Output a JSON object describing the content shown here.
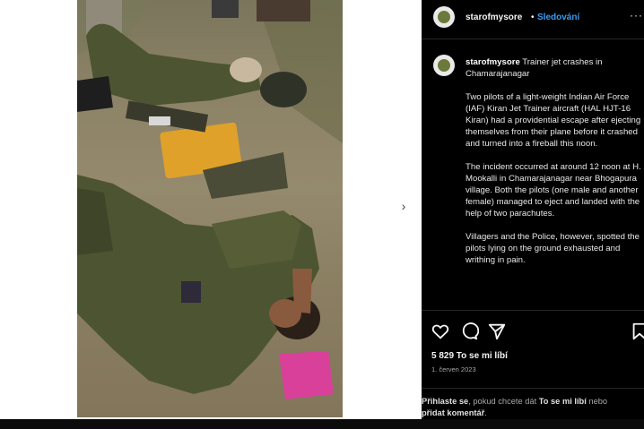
{
  "post": {
    "username": "starofmysore",
    "separator": "•",
    "follow_label": "Sledování",
    "more_label": "···",
    "next_label": "›"
  },
  "caption": {
    "username": "starofmysore",
    "title": "Trainer jet crashes in Chamarajanagar",
    "paragraphs": [
      "Two pilots of a light-weight Indian Air Force (IAF) Kiran Jet Trainer aircraft (HAL HJT-16 Kiran) had a providential escape after ejecting themselves from their plane before it crashed and turned into a fireball this noon.",
      "The incident occurred at around 12 noon at H. Mookalli in Chamarajanagar near Bhogapura village. Both the pilots (one male and another female) managed to eject and landed with the help of two parachutes.",
      "Villagers and the Police, however, spotted the pilots lying on the ground exhausted and writhing in pain."
    ]
  },
  "actions": {
    "icons": [
      "heart-icon",
      "comment-icon",
      "share-icon",
      "bookmark-icon"
    ],
    "likes": "5 829 To se mi líbí",
    "date": "1. červen 2023"
  },
  "login_prompt": {
    "link1": "Přihlaste se",
    "middle": ", pokud chcete dát ",
    "link2": "To se mi líbí",
    "or": " nebo",
    "link3": "přidat komentář",
    "end": "."
  },
  "colors": {
    "panel_bg": "#000000",
    "follow_blue": "#3a9bf0",
    "uniform_olive": "#4d5431",
    "ground": "#8b8166",
    "cloth_pink": "#d8409a",
    "bag_yellow": "#e0a12a"
  }
}
